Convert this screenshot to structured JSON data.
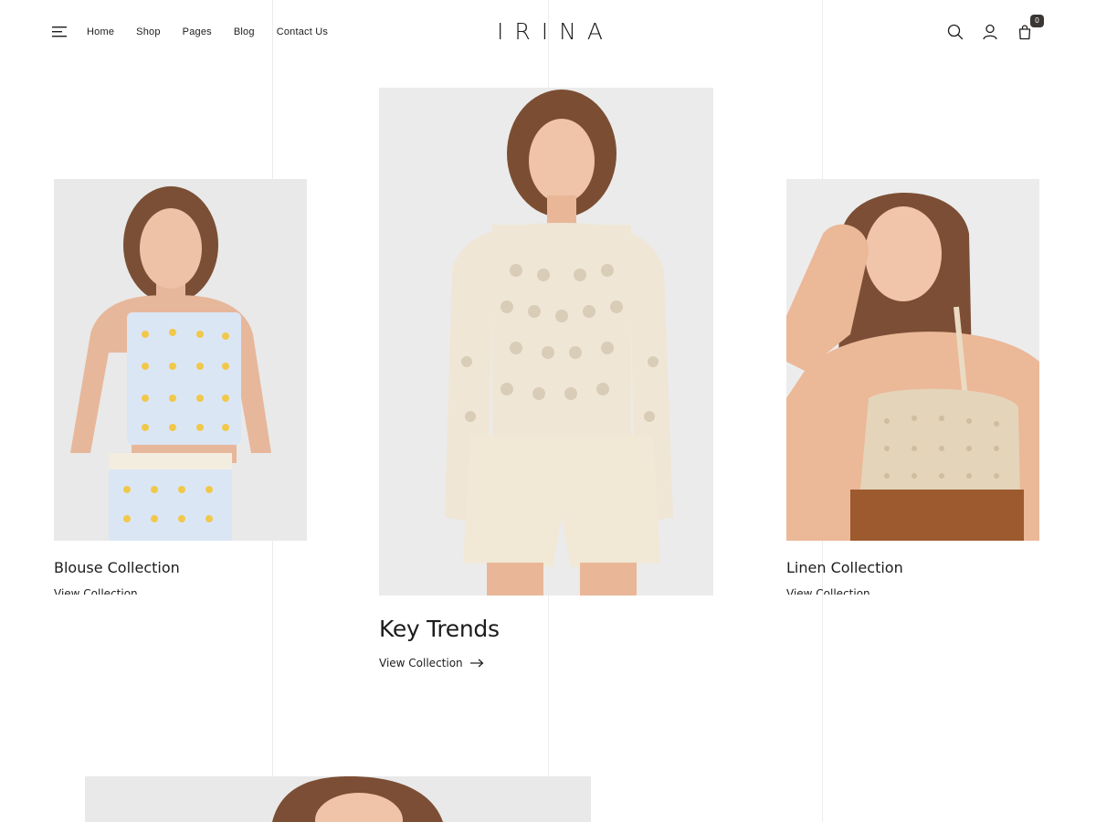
{
  "header": {
    "logo": "IRINA",
    "nav": [
      "Home",
      "Shop",
      "Pages",
      "Blog",
      "Contact Us"
    ],
    "cart_count": "0",
    "icons": [
      "menu-icon",
      "search-icon",
      "user-icon",
      "shopping-bag-icon"
    ]
  },
  "collections": [
    {
      "title": "Blouse Collection",
      "link": "View Collection"
    },
    {
      "title": "Key Trends",
      "link": "View Collection"
    },
    {
      "title": "Linen Collection",
      "link": "View Collection"
    }
  ],
  "colors": {
    "text": "#1c1c1c",
    "badge": "#3a3633",
    "photo_background": "#e9e9e9",
    "guide_line": "#ececec"
  }
}
